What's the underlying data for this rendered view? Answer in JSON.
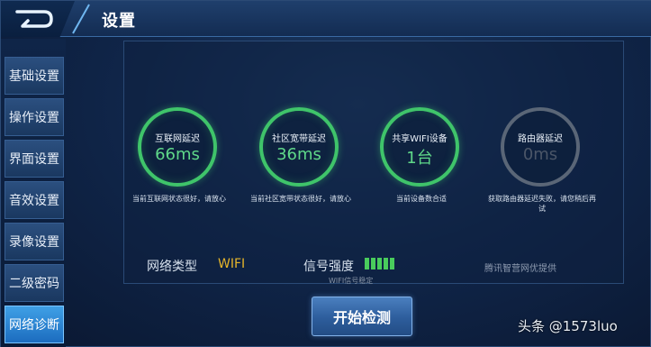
{
  "header": {
    "title": "设置",
    "back_icon": "back-arrow-icon"
  },
  "sidebar": {
    "items": [
      {
        "label": "基础设置",
        "active": false
      },
      {
        "label": "操作设置",
        "active": false
      },
      {
        "label": "界面设置",
        "active": false
      },
      {
        "label": "音效设置",
        "active": false
      },
      {
        "label": "录像设置",
        "active": false
      },
      {
        "label": "二级密码",
        "active": false
      },
      {
        "label": "网络诊断",
        "active": true
      }
    ]
  },
  "diagnostics": [
    {
      "label": "互联网延迟",
      "value": "66ms",
      "note": "当前互联网状态很好，请放心",
      "status": "ok"
    },
    {
      "label": "社区宽带延迟",
      "value": "36ms",
      "note": "当前社区宽带状态很好，请放心",
      "status": "ok"
    },
    {
      "label": "共享WIFI设备",
      "value": "1台",
      "note": "当前设备数合适",
      "status": "ok"
    },
    {
      "label": "路由器延迟",
      "value": "0ms",
      "note": "获取路由器延迟失败，请您稍后再试",
      "status": "fail"
    }
  ],
  "network": {
    "type_label": "网络类型",
    "type_value": "WIFI",
    "signal_label": "信号强度",
    "signal_level": 5,
    "signal_max": 5,
    "signal_note": "WIFI信号稳定"
  },
  "provider_text": "腾讯智营网优提供",
  "start_button": "开始检测",
  "watermark": "头条 @1573luo",
  "colors": {
    "ok": "#3fc46a",
    "fail": "#5a6677",
    "accent_value": "#e6b52a",
    "signal": "#49cc5c"
  }
}
